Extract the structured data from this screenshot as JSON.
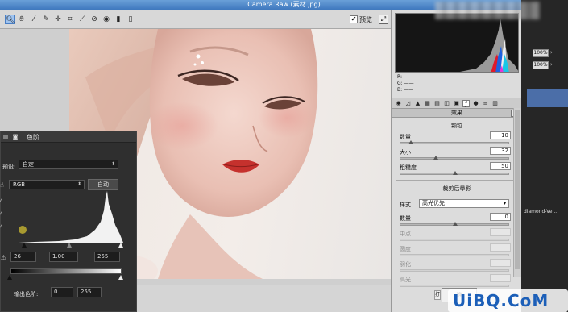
{
  "window": {
    "title": "Camera Raw (素材.jpg)"
  },
  "toolbar": {
    "tools": [
      "zoom-icon",
      "hand-icon",
      "white-balance-icon",
      "color-sampler-icon",
      "targeted-adjustment-icon",
      "crop-icon",
      "straighten-icon",
      "spot-removal-icon",
      "red-eye-icon",
      "adjustment-brush-icon",
      "graduated-filter-icon"
    ],
    "preview_label": "预览",
    "preview_checked": "✔"
  },
  "rgb_readout": {
    "r": "R: ——",
    "g": "G: ——",
    "b": "B: ——"
  },
  "panel": {
    "header": "效果",
    "grain": {
      "title": "颗粒",
      "amount_label": "数量",
      "amount_value": "10",
      "size_label": "大小",
      "size_value": "32",
      "roughness_label": "粗糙度",
      "roughness_value": "50"
    },
    "vignette": {
      "title": "裁剪后晕影",
      "style_label": "样式",
      "style_value": "高光优先",
      "amount_label": "数量",
      "amount_value": "0",
      "midpoint_label": "中点",
      "roundness_label": "圆度",
      "feather_label": "羽化",
      "highlights_label": "高光"
    }
  },
  "ps_panel": {
    "zoom_top": "100%",
    "zoom_bottom": "100%",
    "layer_name": "diamond-Ve..."
  },
  "levels": {
    "title": "色阶",
    "preset_label": "预设:",
    "preset_value": "自定",
    "channel_value": "RGB",
    "auto_label": "自动",
    "input_black": "26",
    "input_gamma": "1.00",
    "input_white": "255",
    "output_label": "输出色阶:",
    "output_black": "0",
    "output_white": "255"
  },
  "buttons": {
    "open": "打",
    "confirm": "确"
  },
  "logo": "UiBQ.CoM",
  "colors": {
    "accent": "#4a7fc4",
    "logo": "#1c5fb8",
    "ps_selection": "#4b6ea8"
  }
}
